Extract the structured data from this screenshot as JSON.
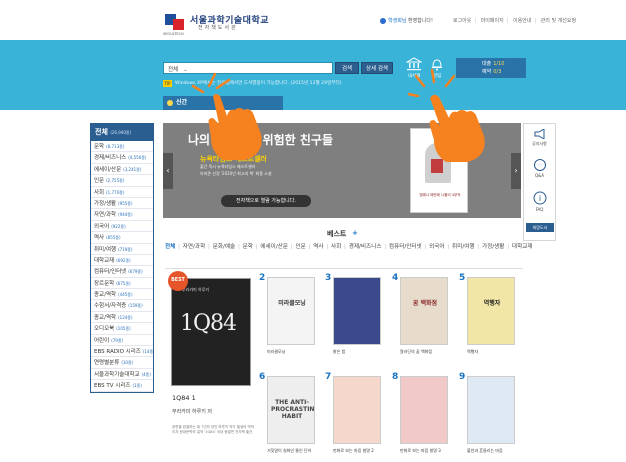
{
  "header": {
    "logo_name": "서울과학기술대학교",
    "logo_sub": "전자책도서관",
    "logo_en": "SEOULTECH",
    "welcome_name": "학생회님",
    "welcome_text": " 환영합니다!",
    "links": [
      "로그아웃",
      "마이페이지",
      "이용안내",
      "관리 및 개선요청"
    ]
  },
  "search": {
    "category": "전체",
    "search_label": "검색",
    "advanced_label": "상세 검색",
    "notice_tag": "TIP",
    "notice": "Windows XP에서는 전용앱에서만 도서열람이 가능합니다. (2015년 12월 29일부터)"
  },
  "quick_icons": {
    "library": "내서재",
    "alarm": "알림"
  },
  "loan": {
    "loan_label": "대출",
    "loan_count": "1/10",
    "reserve_label": "예약",
    "reserve_count": "0/3"
  },
  "tab_new": "신간",
  "sidebar": {
    "title": "전체",
    "count": "(26,940종)",
    "items": [
      {
        "label": "문학",
        "count": "(8,713종)"
      },
      {
        "label": "경제/비즈니스",
        "count": "(4,556종)"
      },
      {
        "label": "에세이/산문",
        "count": "(3,241종)"
      },
      {
        "label": "인문",
        "count": "(2,755종)"
      },
      {
        "label": "사회",
        "count": "(1,770종)"
      },
      {
        "label": "가정/생활",
        "count": "(955종)"
      },
      {
        "label": "자연/과학",
        "count": "(944종)"
      },
      {
        "label": "외국어",
        "count": "(922종)"
      },
      {
        "label": "역사",
        "count": "(855종)"
      },
      {
        "label": "취미/여행",
        "count": "(719종)"
      },
      {
        "label": "대학교재",
        "count": "(692종)"
      },
      {
        "label": "컴퓨터/인터넷",
        "count": "(679종)"
      },
      {
        "label": "장르문학",
        "count": "(675종)"
      },
      {
        "label": "종교/역학",
        "count": "(445종)"
      },
      {
        "label": "수험서/자격증",
        "count": "(159종)"
      },
      {
        "label": "종교/역학",
        "count": "(124종)"
      },
      {
        "label": "오디오북",
        "count": "(105종)"
      },
      {
        "label": "어린이",
        "count": "(79종)"
      },
      {
        "label": "EBS RADIO 시리즈",
        "count": "(14종)"
      },
      {
        "label": "연령별분류",
        "count": "(10종)"
      },
      {
        "label": "서울과학기술대학교",
        "count": "(4종)"
      },
      {
        "label": "EBS TV 시리즈",
        "count": "(1종)"
      }
    ]
  },
  "banner": {
    "title": "나의 친구이자 위험한 친구들",
    "subtitle": "뉴욕타임스 베스트셀러",
    "desc1": "출간 즉시 뉴욕타임스 베스트셀러",
    "desc2": "아마존 선정 '2020년 최고의 책' 최종 소설",
    "button": "전자책으로 열람 가능합니다.",
    "book_text": "엘레나 페란테 나폴리 4부작",
    "prev": "‹",
    "next": "›"
  },
  "quickbar": {
    "notice": "공지사항",
    "qa": "Q&A",
    "faq": "FAQ",
    "request": "희망도서"
  },
  "best": {
    "title": "베스트",
    "plus": "+",
    "tabs": [
      "전체",
      "자연/과학",
      "문화/예술",
      "문학",
      "에세이/산문",
      "인문",
      "역사",
      "사회",
      "경제/비즈니스",
      "컴퓨터/인터넷",
      "외국어",
      "취미/여행",
      "가정/생활",
      "대학교재"
    ],
    "badge": "BEST",
    "first": {
      "title": "1Q84 1",
      "author": "무라카미 하루키 저",
      "desc": "장편을 완결하는 데 7년의 장인 하루키 작가 필생의 역작이자 현대문학의 걸작 '1Q84' 국내 종결편 전자책 출간",
      "cover_text": "1Q84",
      "cover_author": "무라카미 하루키"
    },
    "books": [
      {
        "rank": "2",
        "title": "미라클모닝",
        "cover": "미라클모닝"
      },
      {
        "rank": "3",
        "title": "밝은 밤",
        "cover": ""
      },
      {
        "rank": "4",
        "title": "알라딘의 꿈 백화점",
        "cover": "꿈 백화점"
      },
      {
        "rank": "5",
        "title": "역행자",
        "cover": "역행자"
      },
      {
        "rank": "6",
        "title": "거짓말이 실화인 줄인 단어",
        "cover": "THE ANTI-PROCRASTINATION HABIT"
      },
      {
        "rank": "7",
        "title": "만화로 보는 마음 발명 2",
        "cover": ""
      },
      {
        "rank": "8",
        "title": "만화로 보는 마음 발명 3",
        "cover": ""
      },
      {
        "rank": "9",
        "title": "불안과 흔들리는 마음",
        "cover": ""
      }
    ]
  },
  "colors": {
    "band": "#3ab3d8",
    "primary": "#2a5d90",
    "accent": "#ffd200",
    "rank": "#1a73c0"
  }
}
